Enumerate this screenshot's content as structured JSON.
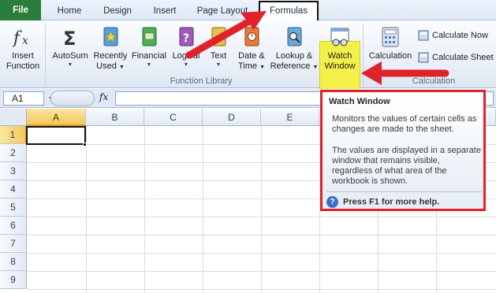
{
  "tabs": [
    {
      "label": "File",
      "name": "tab-file"
    },
    {
      "label": "Home",
      "name": "tab-home"
    },
    {
      "label": "Design",
      "name": "tab-design"
    },
    {
      "label": "Insert",
      "name": "tab-insert"
    },
    {
      "label": "Page Layout",
      "name": "tab-page-layout"
    },
    {
      "label": "Formulas",
      "name": "tab-formulas",
      "active": true
    }
  ],
  "ribbon": {
    "insert_function": {
      "line1": "Insert",
      "line2": "Function"
    },
    "autosum": {
      "label": "AutoSum"
    },
    "recently_used": {
      "line1": "Recently",
      "line2": "Used"
    },
    "financial": {
      "label": "Financial"
    },
    "logical": {
      "label": "Logical"
    },
    "text": {
      "label": "Text"
    },
    "date_time": {
      "line1": "Date &",
      "line2": "Time"
    },
    "lookup": {
      "line1": "Lookup &",
      "line2": "Reference"
    },
    "watch_window": {
      "line1": "Watch",
      "line2": "Window"
    },
    "calculation_options": {
      "line1": "Calculation"
    },
    "calculate_now": "Calculate Now",
    "calculate_sheet": "Calculate Sheet",
    "groups": {
      "function_library": "Function Library",
      "calculation": "Calculation"
    }
  },
  "formula_bar": {
    "name_box": "A1",
    "fx": "fx",
    "value": ""
  },
  "sheet": {
    "columns": [
      "A",
      "B",
      "C",
      "D",
      "E"
    ],
    "rows": [
      "1",
      "2",
      "3",
      "4",
      "5",
      "6",
      "7",
      "8",
      "9"
    ],
    "active_cell": "A1"
  },
  "tooltip": {
    "title": "Watch Window",
    "body1": "Monitors the values of certain cells as changes are made to the sheet.",
    "body2": "The values are displayed in a separate window that remains visible, regardless of what area of the workbook is shown.",
    "help": "Press F1 for more help.",
    "help_icon": "?"
  },
  "colors": {
    "highlight_border": "#e0232b",
    "arrow": "#e0232b",
    "file_tab": "#2a7d3a",
    "watch_highlight": "#f4f04a"
  }
}
